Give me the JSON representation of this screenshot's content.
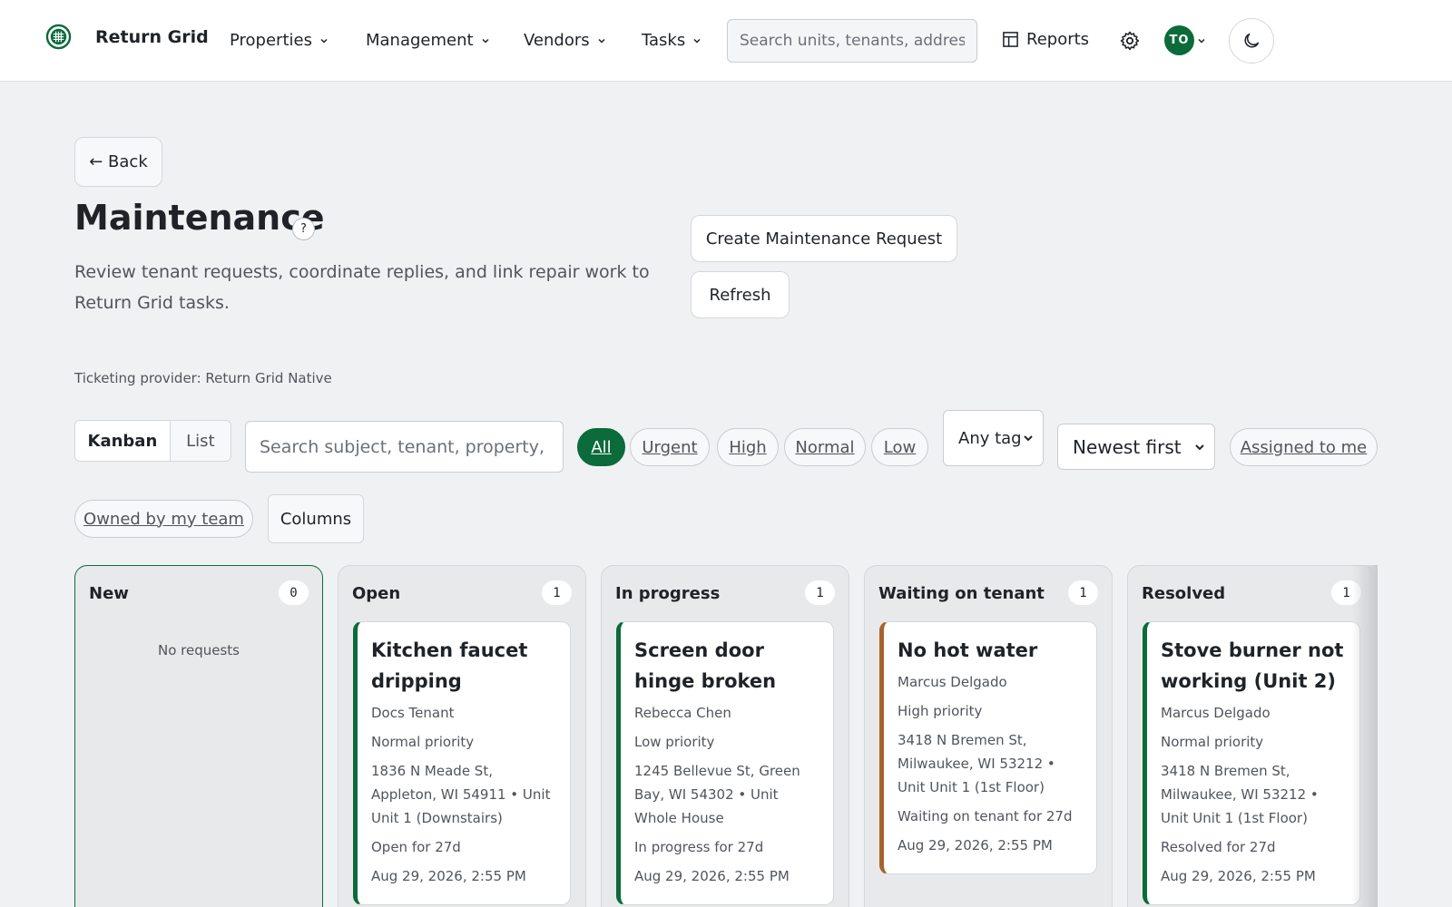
{
  "header": {
    "brand": "Return Grid",
    "nav": [
      {
        "label": "Properties"
      },
      {
        "label": "Management"
      },
      {
        "label": "Vendors"
      },
      {
        "label": "Tasks"
      }
    ],
    "search_placeholder": "Search units, tenants, address",
    "reports_label": "Reports",
    "avatar_initials": "TO"
  },
  "page": {
    "back_label": "← Back",
    "title": "Maintenance",
    "help_label": "?",
    "subtitle": "Review tenant requests, coordinate replies, and link repair work to Return Grid tasks.",
    "create_label": "Create Maintenance Request",
    "refresh_label": "Refresh",
    "provider": "Ticketing provider: Return Grid Native"
  },
  "filters": {
    "view_kanban": "Kanban",
    "view_list": "List",
    "search_placeholder": "Search subject, tenant, property, unit",
    "priority_chips": [
      "All",
      "Urgent",
      "High",
      "Normal",
      "Low"
    ],
    "active_priority": "All",
    "tag_select": "Any tag",
    "sort_select": "Newest first",
    "assigned_chip": "Assigned to me",
    "owned_chip": "Owned by my team",
    "columns_label": "Columns"
  },
  "board": {
    "columns": [
      {
        "name": "New",
        "count": "0",
        "empty_text": "No requests",
        "cards": []
      },
      {
        "name": "Open",
        "count": "1",
        "cards": [
          {
            "title": "Kitchen faucet dripping",
            "tenant": "Docs Tenant",
            "priority": "Normal priority",
            "address": "1836 N Meade St, Appleton, WI 54911 • Unit Unit 1 (Downstairs)",
            "status": "Open for 27d",
            "date": "Aug 29, 2026, 2:55 PM"
          }
        ]
      },
      {
        "name": "In progress",
        "count": "1",
        "cards": [
          {
            "title": "Screen door hinge broken",
            "tenant": "Rebecca Chen",
            "priority": "Low priority",
            "address": "1245 Bellevue St, Green Bay, WI 54302 • Unit Whole House",
            "status": "In progress for 27d",
            "date": "Aug 29, 2026, 2:55 PM"
          }
        ]
      },
      {
        "name": "Waiting on tenant",
        "count": "1",
        "cards": [
          {
            "title": "No hot water",
            "tenant": "Marcus Delgado",
            "priority": "High priority",
            "address": "3418 N Bremen St, Milwaukee, WI 53212 • Unit Unit 1 (1st Floor)",
            "status": "Waiting on tenant for 27d",
            "date": "Aug 29, 2026, 2:55 PM"
          }
        ]
      },
      {
        "name": "Resolved",
        "count": "1",
        "cards": [
          {
            "title": "Stove burner not working (Unit 2)",
            "tenant": "Marcus Delgado",
            "priority": "Normal priority",
            "address": "3418 N Bremen St, Milwaukee, WI 53212 • Unit Unit 1 (1st Floor)",
            "status": "Resolved for 27d",
            "date": "Aug 29, 2026, 2:55 PM"
          }
        ]
      }
    ]
  },
  "colors": {
    "brand_green": "#0b6b3a",
    "waiting_accent": "#a5652a",
    "page_bg": "#f0f1f3"
  },
  "icons": [
    "grid-logo-icon",
    "chevron-down-icon",
    "table-icon",
    "gear-icon",
    "moon-icon",
    "arrow-left-icon",
    "help-icon"
  ]
}
